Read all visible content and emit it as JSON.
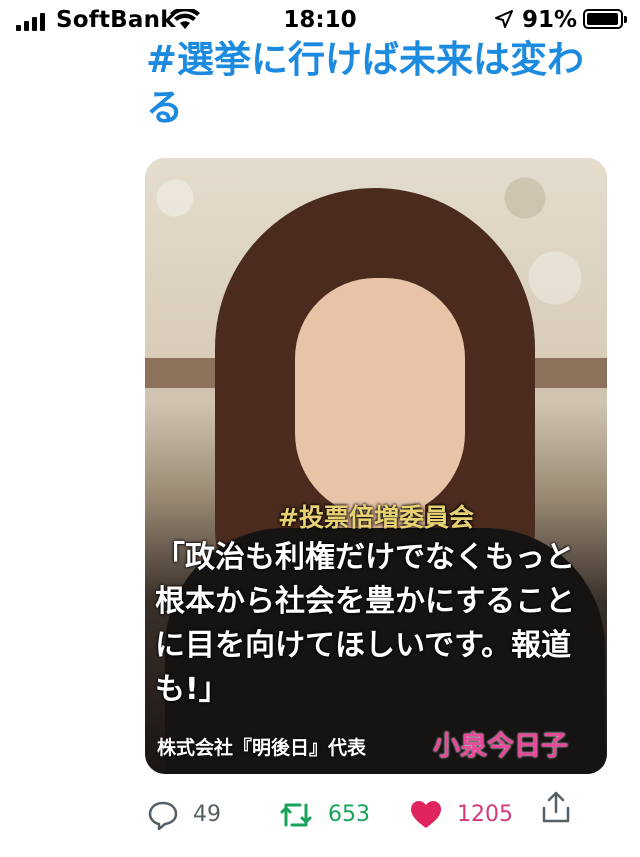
{
  "status_bar": {
    "carrier": "SoftBank",
    "time": "18:10",
    "battery_percent": "91%",
    "icons": [
      "signal-icon",
      "wifi-icon",
      "location-arrow-icon",
      "battery-icon"
    ]
  },
  "tweet": {
    "hashtag": "#選挙に行けば未来は変わる",
    "image": {
      "tag": "#投票倍増委員会",
      "quote": "「政治も利権だけでなくもっと根本から社会を豊かにすることに目を向けてほしいです。報道も!」",
      "company": "株式会社『明後日』代表",
      "person": "小泉今日子"
    },
    "actions": {
      "replies": "49",
      "retweets": "653",
      "likes": "1205"
    }
  },
  "colors": {
    "hashtag": "#1c8adf",
    "retweet": "#17a35a",
    "like": "#d23b7d",
    "person_name": "#e84a9a",
    "tag": "#e8d173"
  }
}
